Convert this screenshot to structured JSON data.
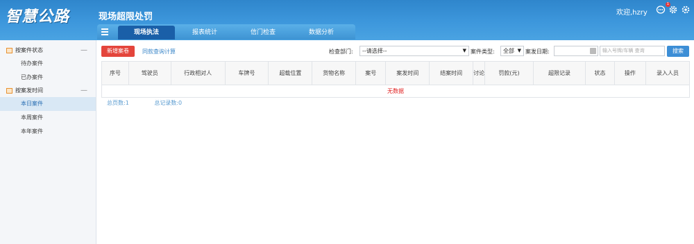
{
  "header": {
    "logo": "智慧公路",
    "system_title": "现场超限处罚",
    "welcome": "欢迎,hzry",
    "notification_count": "1",
    "colors": {
      "header_bg": "#3d97dc",
      "active_tab": "#1a5fa8",
      "danger": "#e4453c",
      "primary": "#3c8ed6"
    }
  },
  "tabs": [
    "现场执法",
    "报表统计",
    "信门检查",
    "数据分析"
  ],
  "sidebar": {
    "groups": [
      {
        "label": "按案件状态",
        "items": [
          "待办案件",
          "已办案件"
        ]
      },
      {
        "label": "按案发时间",
        "items": [
          "本日案件",
          "本周案件",
          "本年案件"
        ]
      }
    ]
  },
  "toolbar": {
    "new_button": "新增案卷",
    "sync_link": "同款查询计算",
    "dept_label": "检查部门:",
    "dept_value": "--请选择--",
    "type_label": "案件类型:",
    "type_value": "全部",
    "date_label": "案发日期:",
    "search_placeholder": "输入号牌/车辆 查询",
    "search_button": "搜索"
  },
  "table": {
    "columns": [
      "序号",
      "驾驶员",
      "行政相对人",
      "车牌号",
      "超载位置",
      "货物名称",
      "案号",
      "案发时间",
      "结案时间",
      "讨论",
      "罚款(元)",
      "超限记录",
      "状态",
      "操作",
      "录入人员"
    ],
    "empty_text": "无数据"
  },
  "pager": {
    "total_pages": "总页数:1",
    "total_records": "总记录数:0"
  }
}
